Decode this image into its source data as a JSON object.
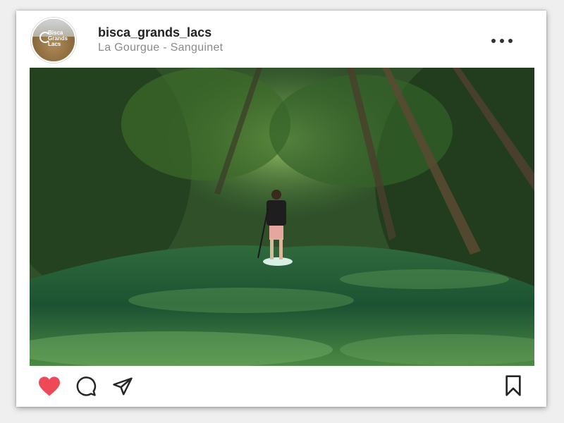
{
  "post": {
    "username": "bisca_grands_lacs",
    "location": "La Gourgue - Sanguinet",
    "avatar_text": "Bisca Grands Lacs"
  },
  "icons": {
    "more": "more-options-icon",
    "like": "heart-icon",
    "comment": "comment-icon",
    "share": "send-icon",
    "save": "bookmark-icon"
  },
  "colors": {
    "like_active": "#ed4956",
    "icon_stroke": "#262626"
  },
  "state": {
    "liked": true
  }
}
